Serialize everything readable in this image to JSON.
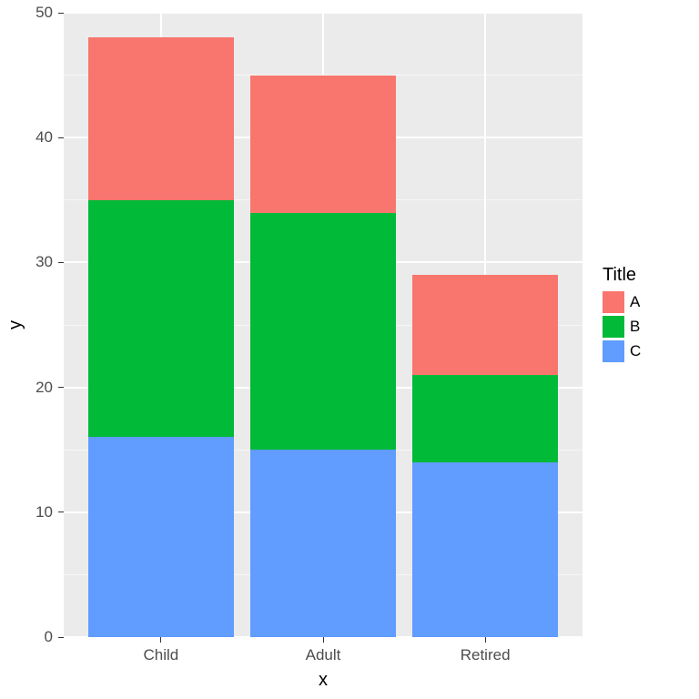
{
  "chart_data": {
    "type": "bar",
    "stacked": true,
    "categories": [
      "Child",
      "Adult",
      "Retired"
    ],
    "series": [
      {
        "name": "A",
        "values": [
          13,
          11,
          8
        ],
        "color": "#f8766d"
      },
      {
        "name": "B",
        "values": [
          19,
          19,
          7
        ],
        "color": "#00ba38"
      },
      {
        "name": "C",
        "values": [
          16,
          15,
          14
        ],
        "color": "#619cff"
      }
    ],
    "stack_order_bottom_to_top": [
      "C",
      "B",
      "A"
    ],
    "totals": [
      48,
      45,
      29
    ],
    "xlabel": "x",
    "ylabel": "y",
    "title": "",
    "ylim": [
      0,
      50
    ],
    "y_ticks": [
      0,
      10,
      20,
      30,
      40,
      50
    ],
    "legend_title": "Title",
    "legend_position": "right"
  }
}
